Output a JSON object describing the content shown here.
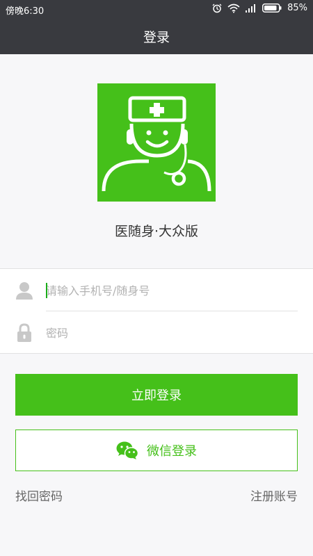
{
  "status_bar": {
    "time": "傍晚6:30",
    "battery": "85%"
  },
  "header": {
    "title": "登录"
  },
  "app": {
    "name": "医随身·大众版"
  },
  "form": {
    "phone_placeholder": "请输入手机号/随身号",
    "password_placeholder": "密码"
  },
  "buttons": {
    "login": "立即登录",
    "wechat_login": "微信登录"
  },
  "links": {
    "forgot_password": "找回密码",
    "register": "注册账号"
  },
  "colors": {
    "brand_green": "#45c01a",
    "header_bg": "#393a3f",
    "page_bg": "#f7f7f9"
  },
  "icons": [
    "alarm-icon",
    "wifi-icon",
    "signal-icon",
    "battery-icon",
    "user-icon",
    "lock-icon",
    "wechat-icon",
    "doctor-logo-icon"
  ]
}
